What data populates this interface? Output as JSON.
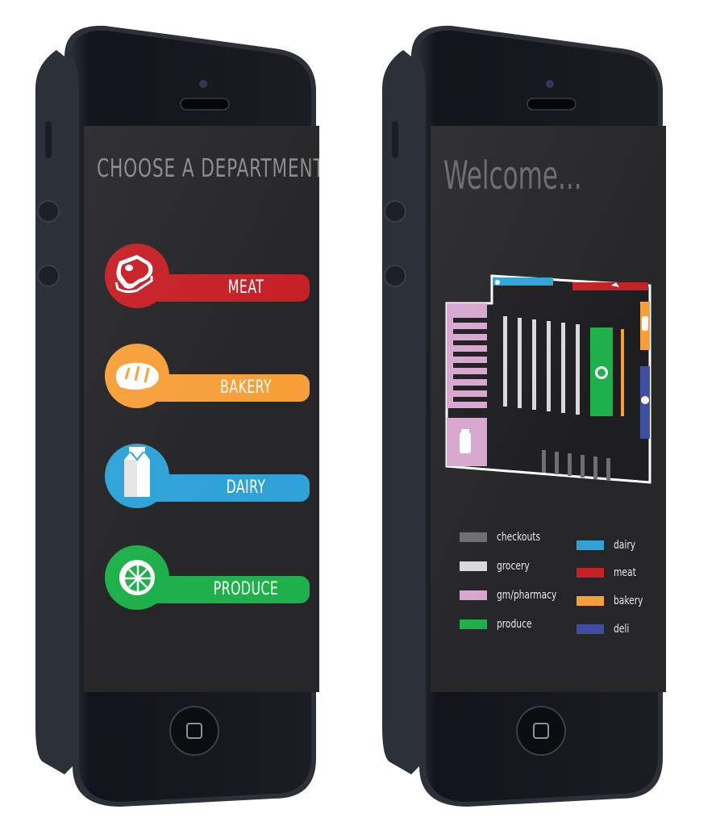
{
  "left_screen": {
    "title": "CHOOSE A DEPARTMENT.",
    "departments": [
      {
        "label": "MEAT",
        "color": "#c62026",
        "icon": "steak-icon"
      },
      {
        "label": "BAKERY",
        "color": "#f7a03a",
        "icon": "bread-icon"
      },
      {
        "label": "DAIRY",
        "color": "#2fa3d8",
        "icon": "milk-carton-icon"
      },
      {
        "label": "PRODUCE",
        "color": "#1eb04b",
        "icon": "citrus-slice-icon"
      }
    ]
  },
  "right_screen": {
    "title": "Welcome...",
    "legend": [
      {
        "label": "checkouts",
        "color": "#6d6e71"
      },
      {
        "label": "grocery",
        "color": "#d9d9db"
      },
      {
        "label": "gm/pharmacy",
        "color": "#d7a6d0"
      },
      {
        "label": "produce",
        "color": "#1eb04b"
      },
      {
        "label": "dairy",
        "color": "#2fa3d8"
      },
      {
        "label": "meat",
        "color": "#c62026"
      },
      {
        "label": "bakery",
        "color": "#f7a03a"
      },
      {
        "label": "deli",
        "color": "#3f4ea0"
      }
    ]
  }
}
